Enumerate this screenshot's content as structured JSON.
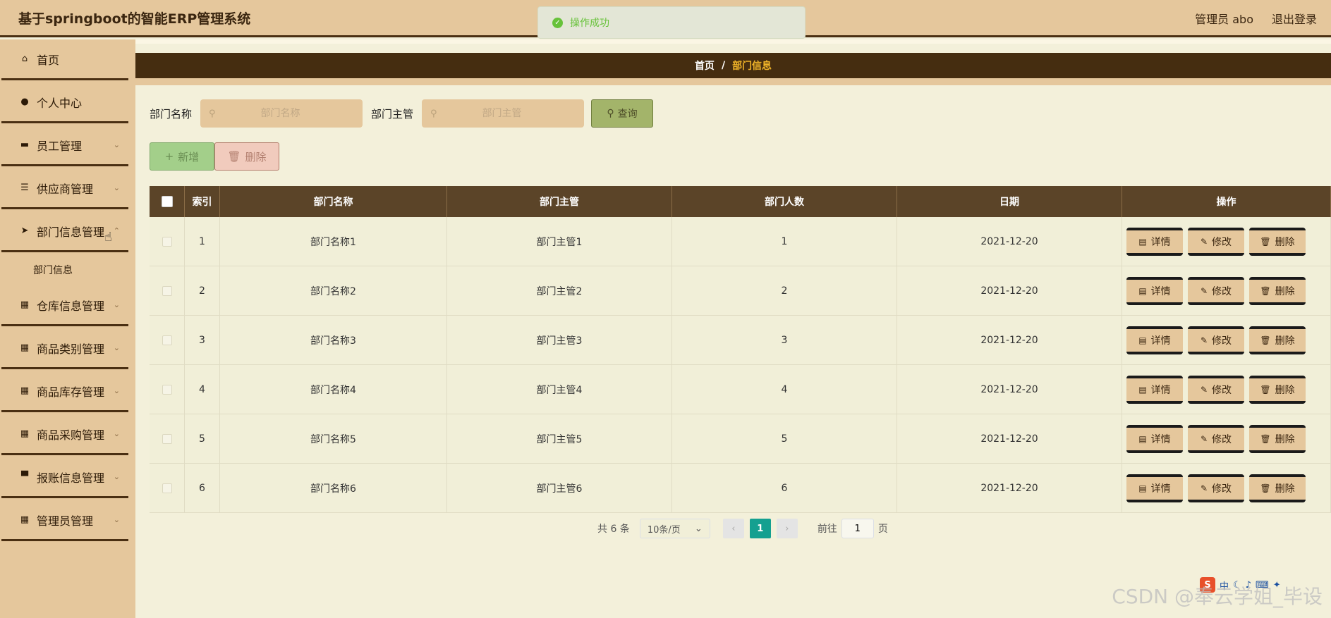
{
  "app": {
    "title": "基于springboot的智能ERP管理系统"
  },
  "header": {
    "user": "管理员 abo",
    "logout": "退出登录"
  },
  "toast": {
    "text": "操作成功",
    "icon": "check-circle-icon"
  },
  "sidebar": {
    "items": [
      {
        "label": "首页",
        "icon": "home-icon"
      },
      {
        "label": "个人中心",
        "icon": "user-icon"
      },
      {
        "label": "员工管理",
        "icon": "chat-icon"
      },
      {
        "label": "供应商管理",
        "icon": "list-icon"
      },
      {
        "label": "部门信息管理",
        "icon": "send-icon"
      },
      {
        "label": "仓库信息管理",
        "icon": "grid-icon"
      },
      {
        "label": "商品类别管理",
        "icon": "grid-icon"
      },
      {
        "label": "商品库存管理",
        "icon": "grid-icon"
      },
      {
        "label": "商品采购管理",
        "icon": "grid-icon"
      },
      {
        "label": "报账信息管理",
        "icon": "monitor-icon"
      },
      {
        "label": "管理员管理",
        "icon": "grid-icon"
      }
    ],
    "sub_item": "部门信息"
  },
  "breadcrumb": {
    "home": "首页",
    "sep": "/",
    "current": "部门信息"
  },
  "search": {
    "name_label": "部门名称",
    "name_placeholder": "部门名称",
    "manager_label": "部门主管",
    "manager_placeholder": "部门主管",
    "query_label": "查询"
  },
  "actions": {
    "add": "新增",
    "delete": "删除"
  },
  "table": {
    "headers": [
      "索引",
      "部门名称",
      "部门主管",
      "部门人数",
      "日期",
      "操作"
    ],
    "rows": [
      {
        "idx": "1",
        "name": "部门名称1",
        "manager": "部门主管1",
        "count": "1",
        "date": "2021-12-20"
      },
      {
        "idx": "2",
        "name": "部门名称2",
        "manager": "部门主管2",
        "count": "2",
        "date": "2021-12-20"
      },
      {
        "idx": "3",
        "name": "部门名称3",
        "manager": "部门主管3",
        "count": "3",
        "date": "2021-12-20"
      },
      {
        "idx": "4",
        "name": "部门名称4",
        "manager": "部门主管4",
        "count": "4",
        "date": "2021-12-20"
      },
      {
        "idx": "5",
        "name": "部门名称5",
        "manager": "部门主管5",
        "count": "5",
        "date": "2021-12-20"
      },
      {
        "idx": "6",
        "name": "部门名称6",
        "manager": "部门主管6",
        "count": "6",
        "date": "2021-12-20"
      }
    ],
    "ops": {
      "detail": "详情",
      "edit": "修改",
      "delete": "删除"
    }
  },
  "pagination": {
    "total": "共 6 条",
    "page_size": "10条/页",
    "current_page": "1",
    "goto_prefix": "前往",
    "goto_value": "1",
    "goto_suffix": "页"
  },
  "watermark": "CSDN @奉云学姐_毕设",
  "ime": "中"
}
